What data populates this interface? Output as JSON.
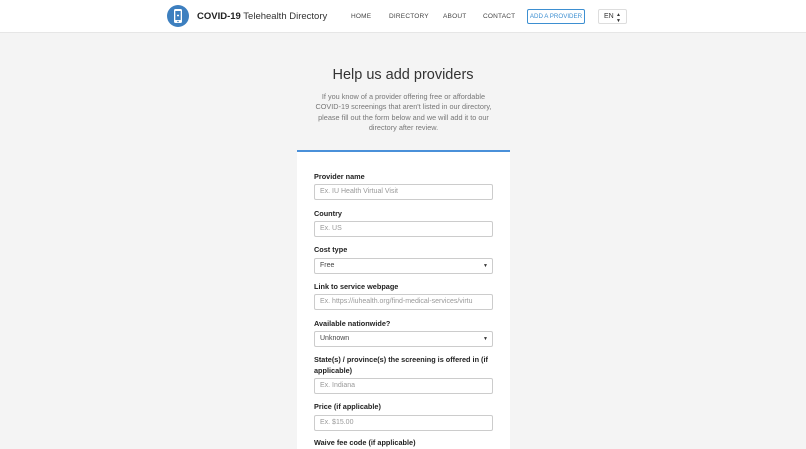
{
  "header": {
    "brand_bold": "COVID-19",
    "brand_rest": " Telehealth Directory",
    "nav": {
      "home": "HOME",
      "directory": "DIRECTORY",
      "about": "ABOUT",
      "contact": "CONTACT"
    },
    "add_provider": "ADD A PROVIDER",
    "language": "EN",
    "accent": "#3d8fd1"
  },
  "page": {
    "title": "Help us add providers",
    "intro": "If you know of a provider offering free or affordable COVID-19 screenings that aren't listed in our directory, please fill out the form below and we will add it to our directory after review."
  },
  "form": {
    "provider_name": {
      "label": "Provider name",
      "placeholder": "Ex. IU Health Virtual Visit"
    },
    "country": {
      "label": "Country",
      "placeholder": "Ex. US"
    },
    "cost_type": {
      "label": "Cost type",
      "value": "Free"
    },
    "link": {
      "label": "Link to service webpage",
      "placeholder": "Ex. https://iuhealth.org/find-medical-services/virtu"
    },
    "nationwide": {
      "label": "Available nationwide?",
      "value": "Unknown"
    },
    "states": {
      "label": "State(s) / province(s) the screening is offered in (if applicable)",
      "placeholder": "Ex. Indiana"
    },
    "price": {
      "label": "Price (if applicable)",
      "placeholder": "Ex. $15.00"
    },
    "waive_code": {
      "label": "Waive fee code (if applicable)"
    }
  }
}
